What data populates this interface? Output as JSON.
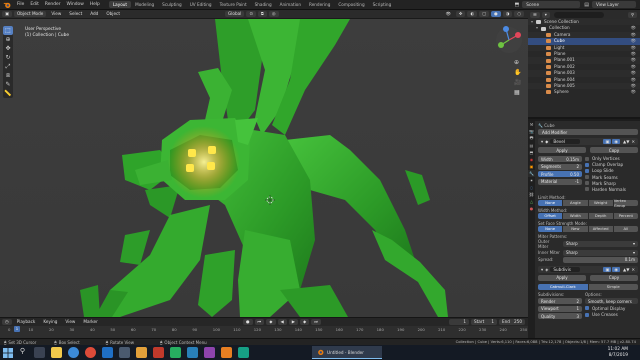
{
  "topbar": {
    "menus": [
      "File",
      "Edit",
      "Render",
      "Window",
      "Help"
    ],
    "workspaces": [
      "Layout",
      "Modeling",
      "Sculpting",
      "UV Editing",
      "Texture Paint",
      "Shading",
      "Animation",
      "Rendering",
      "Compositing",
      "Scripting"
    ],
    "active_workspace": "Layout",
    "scene_label": "Scene",
    "view_layer_label": "View Layer"
  },
  "viewport_header": {
    "mode": "Object Mode",
    "menus": [
      "View",
      "Select",
      "Add",
      "Object"
    ],
    "orientation": "Global"
  },
  "viewport": {
    "perspective": "User Perspective",
    "object_path": "(1) Collection | Cube"
  },
  "outliner": {
    "items": [
      {
        "label": "Scene Collection",
        "indent": 0,
        "color": "#cccccc"
      },
      {
        "label": "Collection",
        "indent": 1,
        "color": "#cccccc"
      },
      {
        "label": "Camera",
        "indent": 2,
        "color": "#d98b4a"
      },
      {
        "label": "Cube",
        "indent": 2,
        "color": "#d98b4a",
        "selected": true
      },
      {
        "label": "Light",
        "indent": 2,
        "color": "#d98b4a"
      },
      {
        "label": "Plane",
        "indent": 2,
        "color": "#d98b4a"
      },
      {
        "label": "Plane.001",
        "indent": 2,
        "color": "#d98b4a"
      },
      {
        "label": "Plane.002",
        "indent": 2,
        "color": "#d98b4a"
      },
      {
        "label": "Plane.003",
        "indent": 2,
        "color": "#d98b4a"
      },
      {
        "label": "Plane.004",
        "indent": 2,
        "color": "#d98b4a"
      },
      {
        "label": "Plane.005",
        "indent": 2,
        "color": "#d98b4a"
      },
      {
        "label": "Sphere",
        "indent": 2,
        "color": "#d98b4a"
      }
    ]
  },
  "properties": {
    "add_modifier": "Add Modifier",
    "bevel": {
      "name": "Bevel",
      "apply": "Apply",
      "copy": "Copy",
      "width_label": "Width",
      "width_value": "0.15m",
      "segments_label": "Segments",
      "segments_value": "2",
      "profile_label": "Profile",
      "profile_value": "0.50",
      "material_label": "Material",
      "material_value": "-1",
      "options": [
        "Only Vertices",
        "Clamp Overlap",
        "Loop Slide",
        "Mark Seams",
        "Mark Sharp",
        "Harden Normals"
      ],
      "limit_method_label": "Limit Method:",
      "limit_methods": [
        "None",
        "Angle",
        "Weight",
        "Vertex Group"
      ],
      "width_method_label": "Width Method:",
      "width_methods": [
        "Offset",
        "Width",
        "Depth",
        "Percent"
      ],
      "face_strength_label": "Set Face Strength Mode:",
      "face_strength": [
        "None",
        "New",
        "Affected",
        "All"
      ],
      "miter_label": "Miter Patterns:",
      "outer_miter_label": "Outer Miter",
      "outer_miter_value": "Sharp",
      "inner_miter_label": "Inner Miter",
      "inner_miter_value": "Sharp",
      "spread_label": "Spread:",
      "spread_value": "0.1m"
    },
    "subsurf": {
      "name": "Subdivis",
      "type_options": [
        "Catmull-Clark",
        "Simple"
      ],
      "apply": "Apply",
      "copy": "Copy",
      "subdivisions_label": "Subdivisions:",
      "options_label": "Options:",
      "render_label": "Render",
      "render_value": "2",
      "viewport_label": "Viewport",
      "viewport_value": "1",
      "quality_label": "Quality",
      "quality_value": "3",
      "uv_smooth": "Smooth, keep corners",
      "opt1": "Optimal Display",
      "opt2": "Use Creases"
    }
  },
  "timeline": {
    "menus": [
      "Playback",
      "Keying",
      "View",
      "Marker"
    ],
    "current_frame": "1",
    "start_label": "Start",
    "start_value": "1",
    "end_label": "End",
    "end_value": "250",
    "ticks": [
      "0",
      "10",
      "20",
      "30",
      "40",
      "50",
      "60",
      "70",
      "80",
      "90",
      "100",
      "110",
      "120",
      "130",
      "140",
      "150",
      "160",
      "170",
      "180",
      "190",
      "200",
      "210",
      "220",
      "230",
      "240",
      "250"
    ]
  },
  "status": {
    "left1": "Set 3D Cursor",
    "left2": "Box Select",
    "left3": "Rotate View",
    "left4": "Object Context Menu",
    "stats": "Collection | Cube | Verts:6,110 | Faces:6,088 | Tris:12,178 | Objects:1/8 | Mem: 57.7 MB | v2.80.74"
  },
  "taskbar": {
    "active_app": "Untitled - Blender",
    "time": "11:02 AM",
    "date": "8/7/2019"
  },
  "colors": {
    "accent": "#4772b3",
    "creature_green": "#2fa02a",
    "eye_glow": "#ffe74a"
  }
}
